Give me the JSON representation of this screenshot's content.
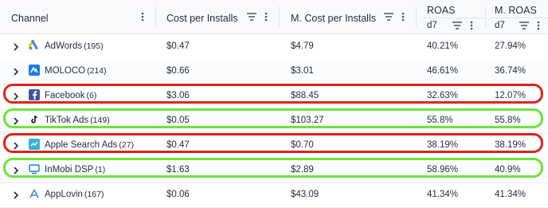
{
  "header": {
    "channel": "Channel",
    "cost_per_installs": "Cost per Installs",
    "m_cost_per_installs": "M. Cost per Installs",
    "roas": "ROAS",
    "m_roas": "M. ROAS",
    "roas_sub": "d7",
    "m_roas_sub": "d7"
  },
  "rows": [
    {
      "name": "AdWords",
      "count": "(195)",
      "cpi": "$0.47",
      "mcpi": "$4.79",
      "roas": "40.21%",
      "mroas": "27.94%",
      "logo": "adwords-icon"
    },
    {
      "name": "MOLOCO",
      "count": "(214)",
      "cpi": "$0.66",
      "mcpi": "$3.01",
      "roas": "46.61%",
      "mroas": "36.74%",
      "logo": "moloco-icon"
    },
    {
      "name": "Facebook",
      "count": "(6)",
      "cpi": "$3.06",
      "mcpi": "$88.45",
      "roas": "32.63%",
      "mroas": "12.07%",
      "logo": "facebook-icon"
    },
    {
      "name": "TikTok Ads",
      "count": "(149)",
      "cpi": "$0.05",
      "mcpi": "$103.27",
      "roas": "55.8%",
      "mroas": "55.8%",
      "logo": "tiktok-icon"
    },
    {
      "name": "Apple Search Ads",
      "count": "(27)",
      "cpi": "$0.47",
      "mcpi": "$0.70",
      "roas": "38.19%",
      "mroas": "38.19%",
      "logo": "apple-search-ads-icon"
    },
    {
      "name": "InMobi DSP",
      "count": "(1)",
      "cpi": "$1.63",
      "mcpi": "$2.89",
      "roas": "58.96%",
      "mroas": "40.9%",
      "logo": "inmobi-icon"
    },
    {
      "name": "AppLovin",
      "count": "(167)",
      "cpi": "$0.06",
      "mcpi": "$43.09",
      "roas": "41.34%",
      "mroas": "41.34%",
      "logo": "applovin-icon"
    }
  ],
  "highlight_colors": {
    "red": "#e0231b",
    "green": "#6ee33a"
  }
}
